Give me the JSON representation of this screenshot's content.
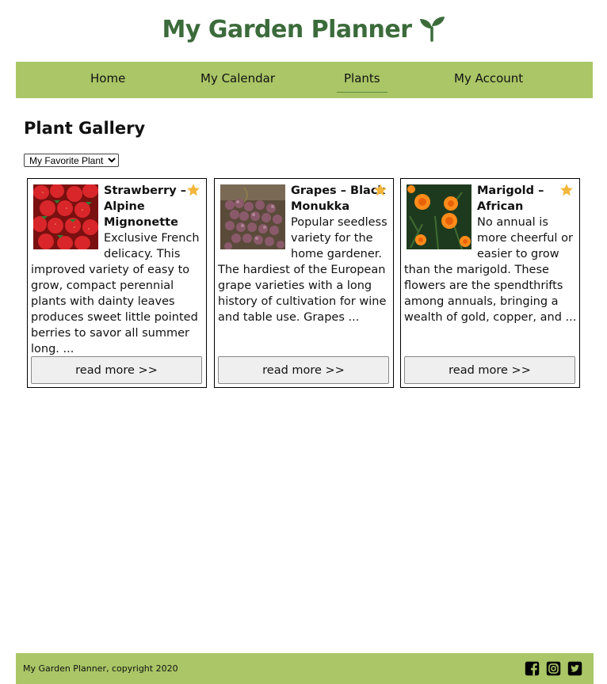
{
  "header": {
    "title": "My Garden Planner",
    "logo_icon": "seedling-icon",
    "brand_color": "#3b6b3a"
  },
  "nav": {
    "background": "#aac666",
    "items": [
      {
        "label": "Home"
      },
      {
        "label": "My Calendar"
      },
      {
        "label": "Plants",
        "active": true
      },
      {
        "label": "My Account"
      }
    ]
  },
  "main": {
    "heading": "Plant Gallery",
    "filter": {
      "selected": "My Favorite Plants",
      "options": [
        "My Favorite Plants"
      ]
    },
    "cards": [
      {
        "name": "Strawberry – Alpine Mignonette",
        "description": "Exclusive French delicacy. This improved variety of easy to grow, compact perennial plants with dainty leaves produces sweet little pointed berries to savor all summer long. ...",
        "favorite": true,
        "image": "strawberries-photo",
        "button": "read more >>"
      },
      {
        "name": "Grapes – Black Monukka",
        "description": "Popular seedless variety for the home gardener. The hardiest of the European grape varieties with a long history of cultivation for wine and table use. Grapes ...",
        "favorite": true,
        "image": "grapes-photo",
        "button": "read more >>"
      },
      {
        "name": "Marigold – African",
        "description": "No annual is more cheerful or easier to grow than the marigold. These flowers are the spendthrifts among annuals, bringing a wealth of gold, copper, and ...",
        "favorite": true,
        "image": "marigold-photo",
        "button": "read more >>"
      }
    ],
    "star_color": "#f4b63a"
  },
  "footer": {
    "copyright": "My Garden Planner, copyright 2020",
    "social": [
      "facebook-icon",
      "instagram-icon",
      "twitter-icon"
    ]
  }
}
